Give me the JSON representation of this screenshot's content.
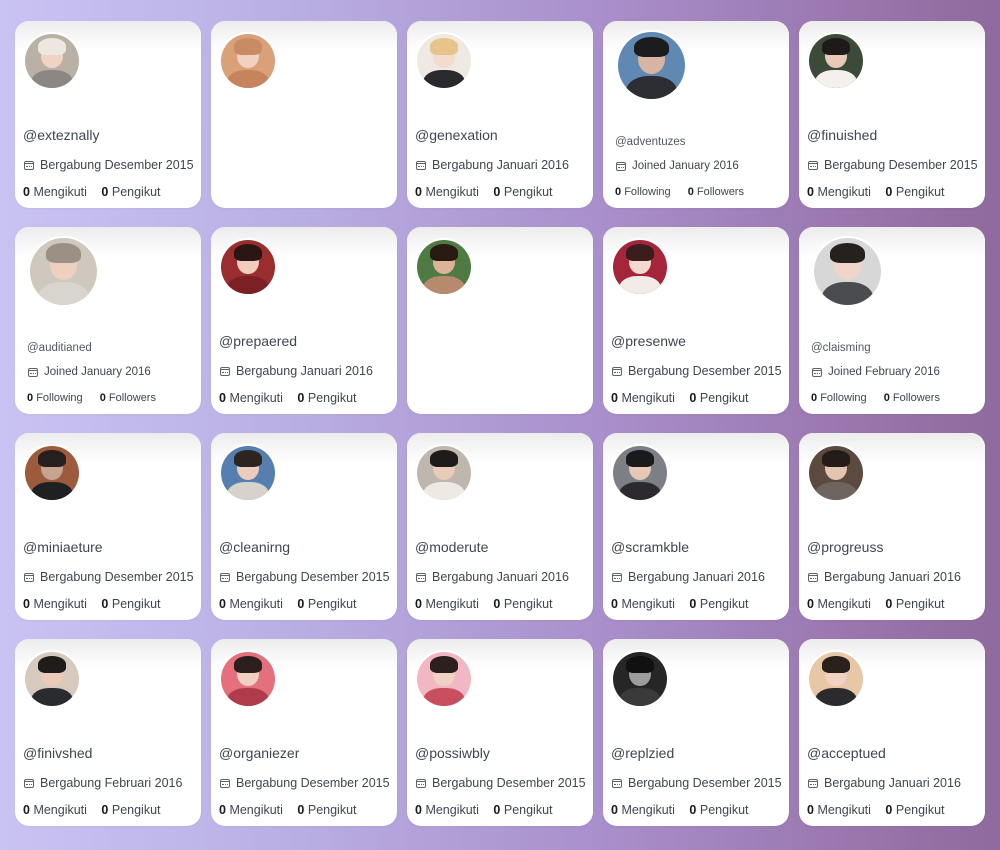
{
  "cards": [
    {
      "handle": "@exteznally",
      "joined": "Bergabung Desember 2015",
      "following": "0",
      "following_label": "Mengikuti",
      "followers": "0",
      "followers_label": "Pengikut",
      "avatar": {
        "bg": "#b9b0a6",
        "skin": "#f0d3c2",
        "hair": "#ece7df",
        "shirt": "#8c8782"
      }
    },
    {
      "handle": "",
      "joined": "",
      "following": "",
      "following_label": "",
      "followers": "",
      "followers_label": "",
      "avatar": {
        "bg": "#d9a07a",
        "skin": "#f2d2bf",
        "hair": "#c98b63",
        "shirt": "#c6845d"
      }
    },
    {
      "handle": "@genexation",
      "joined": "Bergabung Januari 2016",
      "following": "0",
      "following_label": "Mengikuti",
      "followers": "0",
      "followers_label": "Pengikut",
      "avatar": {
        "bg": "#efe9e4",
        "skin": "#f4dccd",
        "hair": "#e7c58a",
        "shirt": "#2a2a2e"
      }
    },
    {
      "handle": "@adventuzes",
      "joined": "Joined January 2016",
      "following": "0",
      "following_label": "Following",
      "followers": "0",
      "followers_label": "Followers",
      "avatar": {
        "bg": "#5f89b3",
        "skin": "#d7b5a2",
        "hair": "#1c1c1f",
        "shirt": "#2d2e33"
      }
    },
    {
      "handle": "@finuished",
      "joined": "Bergabung Desember 2015",
      "following": "0",
      "following_label": "Mengikuti",
      "followers": "0",
      "followers_label": "Pengikut",
      "avatar": {
        "bg": "#3c4a3a",
        "skin": "#eac9b8",
        "hair": "#1e1a1a",
        "shirt": "#f4f0ec"
      }
    },
    {
      "handle": "@auditianed",
      "joined": "Joined January 2016",
      "following": "0",
      "following_label": "Following",
      "followers": "0",
      "followers_label": "Followers",
      "avatar": {
        "bg": "#cfc8bf",
        "skin": "#efcfbd",
        "hair": "#9c8f84",
        "shirt": "#d9d4cd"
      }
    },
    {
      "handle": "@prepaered",
      "joined": "Bergabung Januari 2016",
      "following": "0",
      "following_label": "Mengikuti",
      "followers": "0",
      "followers_label": "Pengikut",
      "avatar": {
        "bg": "#9a2d2f",
        "skin": "#f0cdbd",
        "hair": "#2a1714",
        "shirt": "#7b2024"
      }
    },
    {
      "handle": "",
      "joined": "",
      "following": "",
      "following_label": "",
      "followers": "",
      "followers_label": "",
      "avatar": {
        "bg": "#4f7a43",
        "skin": "#dcb299",
        "hair": "#2a1b12",
        "shirt": "#b78a6e"
      }
    },
    {
      "handle": "@presenwe",
      "joined": "Bergabung Desember 2015",
      "following": "0",
      "following_label": "Mengikuti",
      "followers": "0",
      "followers_label": "Pengikut",
      "avatar": {
        "bg": "#a5263a",
        "skin": "#f3d9cf",
        "hair": "#3a1d1c",
        "shirt": "#f2ece8"
      }
    },
    {
      "handle": "@claisming",
      "joined": "Joined February 2016",
      "following": "0",
      "following_label": "Following",
      "followers": "0",
      "followers_label": "Followers",
      "avatar": {
        "bg": "#d8d7d7",
        "skin": "#efd6c9",
        "hair": "#24211f",
        "shirt": "#4b4c50"
      }
    },
    {
      "handle": "@miniaeture",
      "joined": "Bergabung Desember 2015",
      "following": "0",
      "following_label": "Mengikuti",
      "followers": "0",
      "followers_label": "Pengikut",
      "avatar": {
        "bg": "#9e5a3d",
        "skin": "#c8a390",
        "hair": "#25201d",
        "shirt": "#1f2022"
      }
    },
    {
      "handle": "@cleanirng",
      "joined": "Bergabung Desember 2015",
      "following": "0",
      "following_label": "Mengikuti",
      "followers": "0",
      "followers_label": "Pengikut",
      "avatar": {
        "bg": "#567fb0",
        "skin": "#ebcdbd",
        "hair": "#2e241f",
        "shirt": "#d7d3cc"
      }
    },
    {
      "handle": "@moderute",
      "joined": "Bergabung Januari 2016",
      "following": "0",
      "following_label": "Mengikuti",
      "followers": "0",
      "followers_label": "Pengikut",
      "avatar": {
        "bg": "#bfb6ad",
        "skin": "#e8cbb9",
        "hair": "#1e1b1b",
        "shirt": "#efe9e3"
      }
    },
    {
      "handle": "@scramkble",
      "joined": "Bergabung Januari 2016",
      "following": "0",
      "following_label": "Mengikuti",
      "followers": "0",
      "followers_label": "Pengikut",
      "avatar": {
        "bg": "#7d7f86",
        "skin": "#e6c8b8",
        "hair": "#1a1a1c",
        "shirt": "#2b2b2f"
      }
    },
    {
      "handle": "@progreuss",
      "joined": "Bergabung Januari 2016",
      "following": "0",
      "following_label": "Mengikuti",
      "followers": "0",
      "followers_label": "Pengikut",
      "avatar": {
        "bg": "#5c4a41",
        "skin": "#e4c3b1",
        "hair": "#231c18",
        "shirt": "#6e6561"
      }
    },
    {
      "handle": "@finivshed",
      "joined": "Bergabung Februari 2016",
      "following": "0",
      "following_label": "Mengikuti",
      "followers": "0",
      "followers_label": "Pengikut",
      "avatar": {
        "bg": "#d8c9bf",
        "skin": "#ebcab9",
        "hair": "#1f1c1b",
        "shirt": "#2a2b2f"
      }
    },
    {
      "handle": "@organiezer",
      "joined": "Bergabung Desember 2015",
      "following": "0",
      "following_label": "Mengikuti",
      "followers": "0",
      "followers_label": "Pengikut",
      "avatar": {
        "bg": "#e5707d",
        "skin": "#f0d0c2",
        "hair": "#2c1f1d",
        "shirt": "#b03b4a"
      }
    },
    {
      "handle": "@possiwbly",
      "joined": "Bergabung Desember 2015",
      "following": "0",
      "following_label": "Mengikuti",
      "followers": "0",
      "followers_label": "Pengikut",
      "avatar": {
        "bg": "#f1b7c3",
        "skin": "#f0d2c3",
        "hair": "#2b201d",
        "shirt": "#c8505e"
      }
    },
    {
      "handle": "@replzied",
      "joined": "Bergabung Desember 2015",
      "following": "0",
      "following_label": "Mengikuti",
      "followers": "0",
      "followers_label": "Pengikut",
      "avatar": {
        "bg": "#262626",
        "skin": "#9c9c9c",
        "hair": "#111111",
        "shirt": "#3a3a3a"
      }
    },
    {
      "handle": "@acceptued",
      "joined": "Bergabung Januari 2016",
      "following": "0",
      "following_label": "Mengikuti",
      "followers": "0",
      "followers_label": "Pengikut",
      "avatar": {
        "bg": "#e8c7a6",
        "skin": "#f1d3c3",
        "hair": "#2a201c",
        "shirt": "#2b2b2e"
      }
    }
  ]
}
